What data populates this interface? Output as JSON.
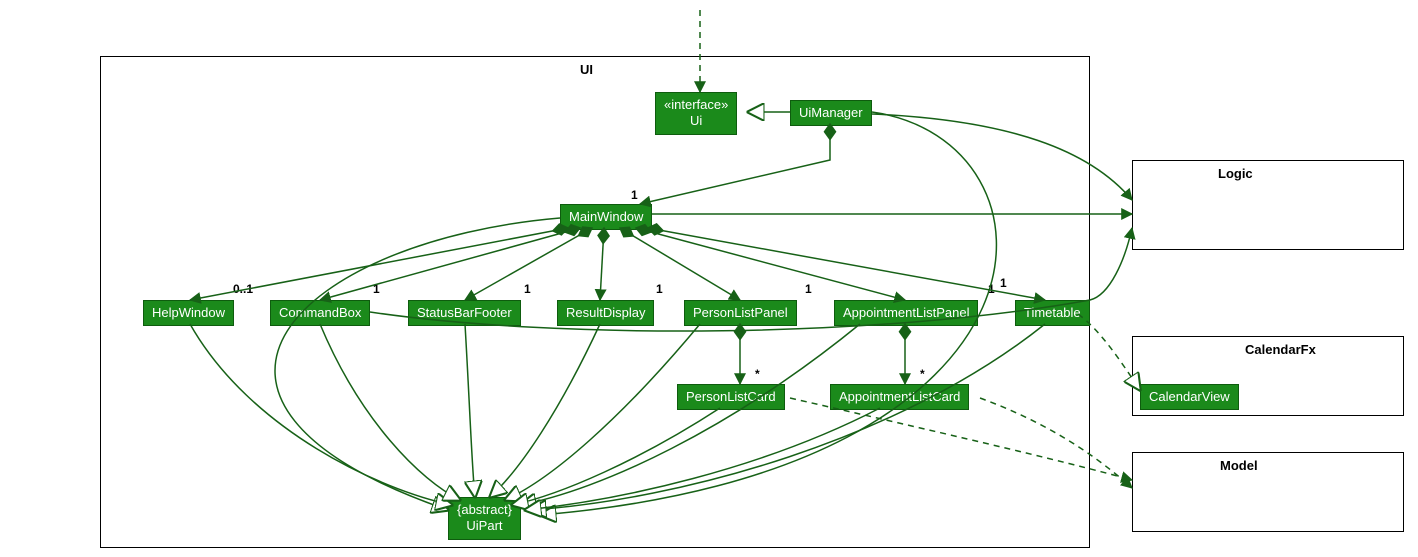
{
  "packages": {
    "ui": {
      "label": "UI"
    },
    "logic": {
      "label": "Logic"
    },
    "calendarfx": {
      "label": "CalendarFx"
    },
    "model": {
      "label": "Model"
    }
  },
  "classes": {
    "ui_interface": {
      "stereotype": "«interface»",
      "name": "Ui"
    },
    "ui_manager": {
      "name": "UiManager"
    },
    "main_window": {
      "name": "MainWindow"
    },
    "help_window": {
      "name": "HelpWindow"
    },
    "command_box": {
      "name": "CommandBox"
    },
    "status_bar_footer": {
      "name": "StatusBarFooter"
    },
    "result_display": {
      "name": "ResultDisplay"
    },
    "person_list_panel": {
      "name": "PersonListPanel"
    },
    "appointment_list_panel": {
      "name": "AppointmentListPanel"
    },
    "timetable": {
      "name": "Timetable"
    },
    "person_list_card": {
      "name": "PersonListCard"
    },
    "appointment_list_card": {
      "name": "AppointmentListCard"
    },
    "ui_part": {
      "stereotype": "{abstract}",
      "name": "UiPart"
    },
    "calendar_view": {
      "name": "CalendarView"
    }
  },
  "multiplicities": {
    "mw_ui": "1",
    "help_window": "0..1",
    "command_box": "1",
    "status_bar_footer": "1",
    "result_display": "1",
    "person_list_panel": "1",
    "appointment_list_panel": "1",
    "timetable": "1",
    "person_list_card": "*",
    "appointment_list_card": "*"
  }
}
